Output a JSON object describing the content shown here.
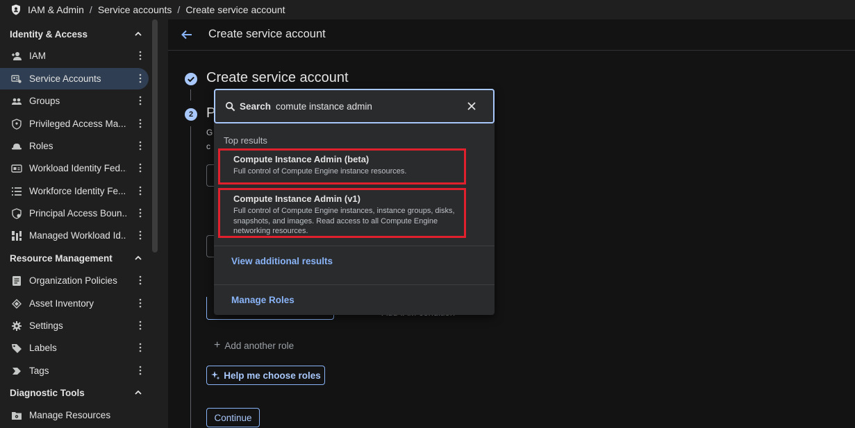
{
  "breadcrumb": {
    "items": [
      "IAM & Admin",
      "Service accounts",
      "Create service account"
    ],
    "separator": "/"
  },
  "sidebar": {
    "sections": [
      {
        "label": "Identity & Access"
      },
      {
        "label": "Resource Management"
      },
      {
        "label": "Diagnostic Tools"
      }
    ],
    "items": [
      {
        "label": "IAM",
        "icon": "person-add-icon"
      },
      {
        "label": "Service Accounts",
        "icon": "service-account-icon",
        "active": true
      },
      {
        "label": "Groups",
        "icon": "groups-icon"
      },
      {
        "label": "Privileged Access Ma...",
        "icon": "shield-icon"
      },
      {
        "label": "Roles",
        "icon": "hat-icon"
      },
      {
        "label": "Workload Identity Fed...",
        "icon": "id-card-icon"
      },
      {
        "label": "Workforce Identity Fe...",
        "icon": "list-icon"
      },
      {
        "label": "Principal Access Boun...",
        "icon": "boundary-icon"
      },
      {
        "label": "Managed Workload Id...",
        "icon": "workload-icon"
      },
      {
        "label": "Organization Policies",
        "icon": "document-icon"
      },
      {
        "label": "Asset Inventory",
        "icon": "diamond-icon"
      },
      {
        "label": "Settings",
        "icon": "gear-icon"
      },
      {
        "label": "Labels",
        "icon": "tag-icon"
      },
      {
        "label": "Tags",
        "icon": "chevron-tag-icon"
      },
      {
        "label": "Manage Resources",
        "icon": "folder-gear-icon"
      }
    ]
  },
  "header": {
    "title": "Create service account"
  },
  "steps": {
    "step1_title": "Create service account",
    "step2_number": "2",
    "step2_title_partial": "P",
    "step2_desc_partial_1": "G",
    "step2_desc_partial_2": "c"
  },
  "actions": {
    "add_condition_partial": "+ Add IAM condition",
    "add_another_role": "Add another role",
    "help_choose_roles": "Help me choose roles",
    "continue": "Continue"
  },
  "dropdown": {
    "search_label": "Search",
    "search_value": "comute instance admin",
    "top_results_heading": "Top results",
    "results": [
      {
        "title": "Compute Instance Admin (beta)",
        "desc": "Full control of Compute Engine instance resources."
      },
      {
        "title": "Compute Instance Admin (v1)",
        "desc": "Full control of Compute Engine instances, instance groups, disks, snapshots, and images. Read access to all Compute Engine networking resources."
      }
    ],
    "view_additional": "View additional results",
    "manage_roles": "Manage Roles"
  },
  "colors": {
    "accent": "#8ab4f8",
    "highlight_border": "#e0202c",
    "active_item": "#2f3e52"
  }
}
